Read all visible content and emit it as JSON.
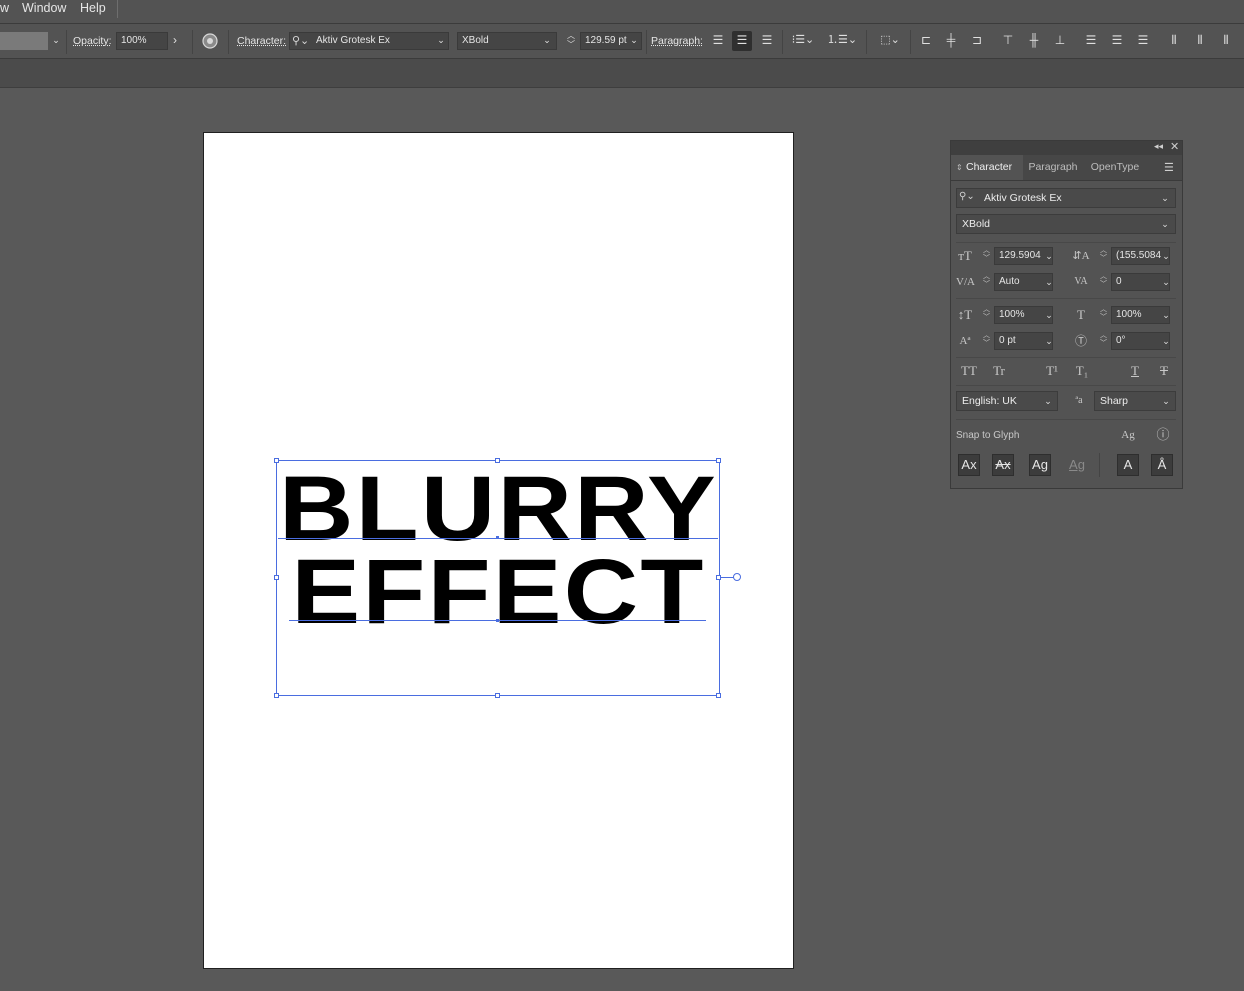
{
  "menubar": {
    "items": [
      "w",
      "Window",
      "Help"
    ]
  },
  "controlbar": {
    "opacity_label": "Opacity:",
    "opacity_value": "100%",
    "character_label": "Character:",
    "font_family": "Aktiv Grotesk Ex",
    "font_style": "XBold",
    "font_size": "129.59 pt",
    "paragraph_label": "Paragraph:",
    "align_active": "center"
  },
  "artboard": {
    "line1": "BLURRY",
    "line2": "EFFECT"
  },
  "panel": {
    "tabs": [
      "Character",
      "Paragraph",
      "OpenType"
    ],
    "font_family": "Aktiv Grotesk Ex",
    "font_style": "XBold",
    "font_size": "129.5904",
    "leading": "(155.5084",
    "kerning": "Auto",
    "tracking": "0",
    "vertical_scale": "100%",
    "horizontal_scale": "100%",
    "baseline_shift": "0 pt",
    "rotation": "0°",
    "type_buttons": [
      "TT",
      "Tr",
      "T¹",
      "T₁",
      "T",
      "T"
    ],
    "language": "English: UK",
    "antialias_label": "ªa",
    "antialias": "Sharp",
    "snap_label": "Snap to Glyph",
    "snap_buttons": [
      "Ax",
      "Ax",
      "Ag",
      "Ag",
      "A",
      "Å"
    ]
  }
}
